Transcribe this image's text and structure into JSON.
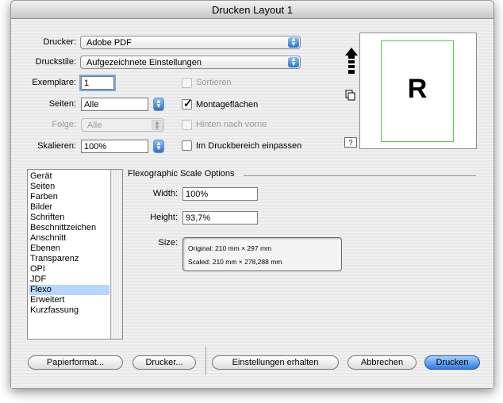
{
  "window": {
    "title": "Drucken Layout 1"
  },
  "form": {
    "printer_label": "Drucker:",
    "printer_value": "Adobe PDF",
    "styles_label": "Druckstile:",
    "styles_value": "Aufgezeichnete Einstellungen",
    "copies_label": "Exemplare:",
    "copies_value": "1",
    "pages_label": "Seiten:",
    "pages_value": "Alle",
    "order_label": "Folge:",
    "order_value": "Alle",
    "scale_label": "Skalieren:",
    "scale_value": "100%",
    "collate_label": "Sortieren",
    "collate_checked": false,
    "spreads_label": "Montageflächen",
    "spreads_checked": true,
    "backtofront_label": "Hinten nach vorne",
    "backtofront_checked": false,
    "fit_label": "Im Druckbereich einpassen",
    "fit_checked": false
  },
  "preview": {
    "letter": "R",
    "help_label": "?"
  },
  "sidebar": {
    "items": [
      {
        "label": "Gerät",
        "selected": false
      },
      {
        "label": "Seiten",
        "selected": false
      },
      {
        "label": "Farben",
        "selected": false
      },
      {
        "label": "Bilder",
        "selected": false
      },
      {
        "label": "Schriften",
        "selected": false
      },
      {
        "label": "Beschnittzeichen",
        "selected": false
      },
      {
        "label": "Anschnitt",
        "selected": false
      },
      {
        "label": "Ebenen",
        "selected": false
      },
      {
        "label": "Transparenz",
        "selected": false
      },
      {
        "label": "OPI",
        "selected": false
      },
      {
        "label": "JDF",
        "selected": false
      },
      {
        "label": "Flexo",
        "selected": true
      },
      {
        "label": "Erweitert",
        "selected": false
      },
      {
        "label": "Kurzfassung",
        "selected": false
      }
    ]
  },
  "flexo": {
    "section_title": "Flexographic Scale Options",
    "width_label": "Width:",
    "width_value": "100%",
    "height_label": "Height:",
    "height_value": "93,7%",
    "size_label": "Size:",
    "original_text": "Original: 210  mm × 297  mm",
    "scaled_text": "Scaled: 210  mm × 278,288  mm"
  },
  "buttons": {
    "paper_format": "Papierformat...",
    "printer": "Drucker...",
    "save_settings": "Einstellungen erhalten",
    "cancel": "Abbrechen",
    "print": "Drucken"
  },
  "colors": {
    "accent": "#2e7ae0",
    "selection": "#b5d5ff",
    "page_border": "#44d044"
  },
  "icons": [
    "up-arrow-icon",
    "copy-pages-icon",
    "popup-arrows-icon",
    "stepper-icon",
    "checkmark-icon"
  ]
}
